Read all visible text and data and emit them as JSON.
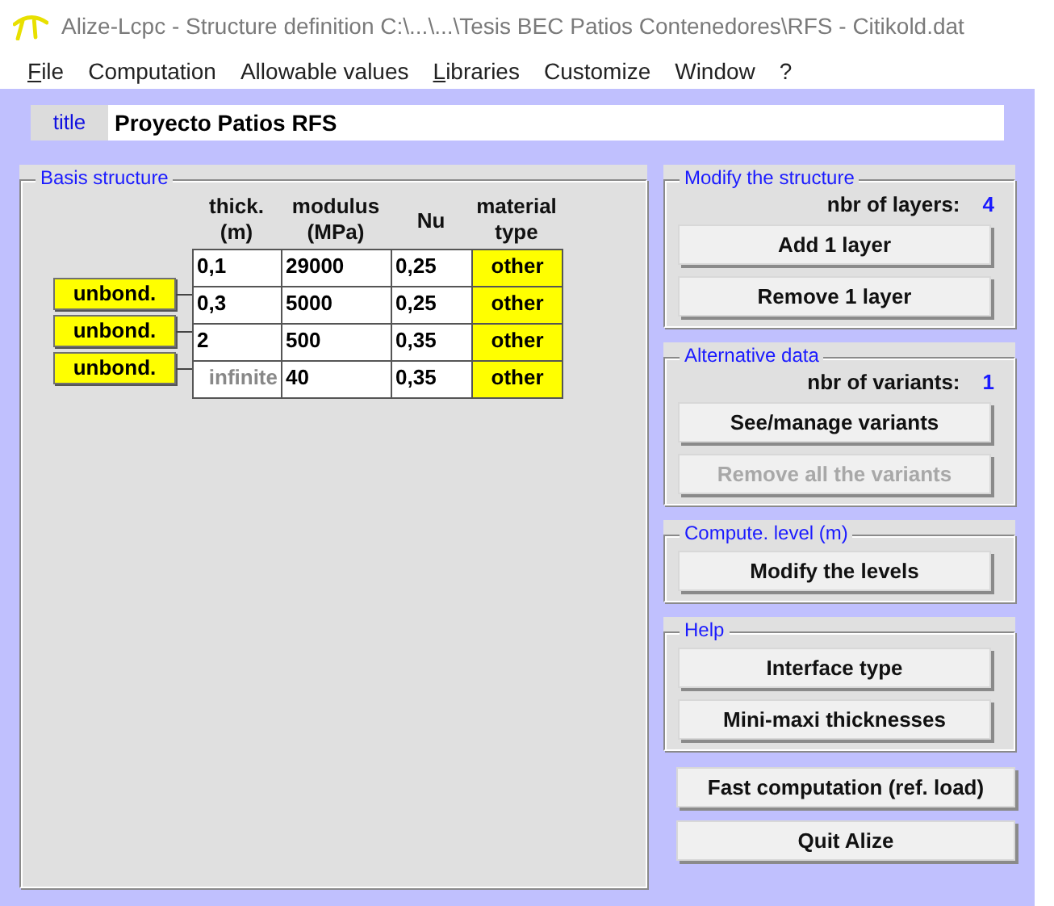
{
  "window": {
    "title": "Alize-Lcpc - Structure definition C:\\...\\...\\Tesis BEC Patios Contenedores\\RFS - Citikold.dat"
  },
  "menu": [
    {
      "label": "File",
      "underlined": true
    },
    {
      "label": "Computation",
      "underlined": false
    },
    {
      "label": "Allowable values",
      "underlined": false
    },
    {
      "label": "Libraries",
      "underlined": true
    },
    {
      "label": "Customize",
      "underlined": false
    },
    {
      "label": "Window",
      "underlined": false
    },
    {
      "label": "?",
      "underlined": false
    }
  ],
  "title_field": {
    "label": "title",
    "value": "Proyecto Patios RFS"
  },
  "basis_structure": {
    "legend": "Basis structure",
    "columns": [
      {
        "line1": "thick.",
        "line2": "(m)"
      },
      {
        "line1": "modulus",
        "line2": "(MPa)"
      },
      {
        "line1": "Nu"
      },
      {
        "line1": "material",
        "line2": "type"
      }
    ],
    "layers": [
      {
        "kind": "layer",
        "thickness": "0,1",
        "modulus": "29000",
        "nu": "0,25",
        "material": "other"
      },
      {
        "kind": "layer",
        "thickness": "0,3",
        "modulus": "5000",
        "nu": "0,25",
        "material": "other"
      },
      {
        "kind": "layer",
        "thickness": "2",
        "modulus": "500",
        "nu": "0,35",
        "material": "other"
      },
      {
        "kind": "infinite",
        "thickness": "infinite",
        "modulus": "40",
        "nu": "0,35",
        "material": "other"
      }
    ],
    "interfaces": [
      "unbond.",
      "unbond.",
      "unbond."
    ]
  },
  "modify_structure": {
    "legend": "Modify the structure",
    "count_label": "nbr of layers:",
    "count": "4",
    "buttons": [
      {
        "label": "Add 1 layer",
        "disabled": false
      },
      {
        "label": "Remove 1 layer",
        "disabled": false
      }
    ]
  },
  "alternative_data": {
    "legend": "Alternative data",
    "count_label": "nbr of variants:",
    "count": "1",
    "buttons": [
      {
        "label": "See/manage variants",
        "disabled": false
      },
      {
        "label": "Remove all the variants",
        "disabled": true
      }
    ]
  },
  "compute_level": {
    "legend": "Compute. level (m)",
    "buttons": [
      {
        "label": "Modify the levels",
        "disabled": false
      }
    ]
  },
  "help": {
    "legend": "Help",
    "buttons": [
      {
        "label": "Interface type",
        "disabled": false
      },
      {
        "label": "Mini-maxi thicknesses",
        "disabled": false
      }
    ]
  },
  "bottom_buttons": [
    {
      "label": "Fast computation (ref. load)",
      "disabled": false
    },
    {
      "label": "Quit Alize",
      "disabled": false
    }
  ]
}
